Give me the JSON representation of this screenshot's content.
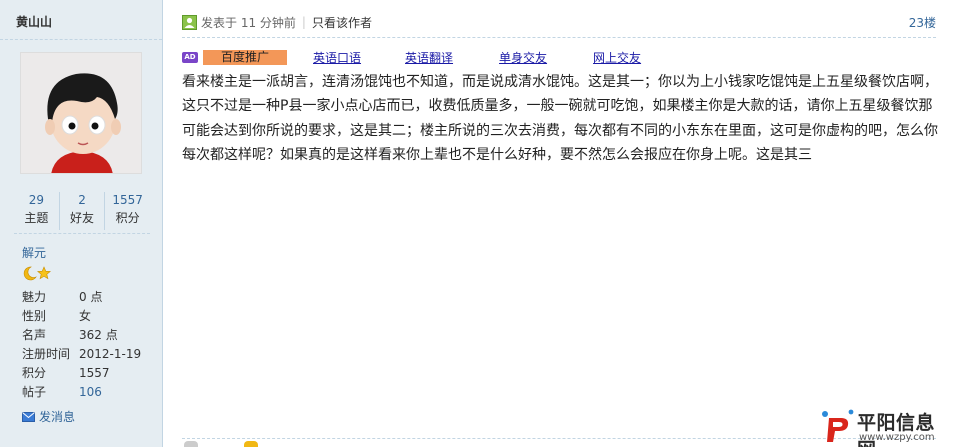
{
  "author": {
    "name": "黄山山",
    "stats": [
      {
        "value": "29",
        "label": "主题"
      },
      {
        "value": "2",
        "label": "好友"
      },
      {
        "value": "1557",
        "label": "积分"
      }
    ],
    "rank": "解元",
    "profile": [
      {
        "key": "魅力",
        "value": "0 点"
      },
      {
        "key": "性别",
        "value": "女"
      },
      {
        "key": "名声",
        "value": "362 点"
      },
      {
        "key": "注册时间",
        "value": "2012-1-19"
      },
      {
        "key": "积分",
        "value": "1557"
      },
      {
        "key": "帖子",
        "value": "106"
      }
    ],
    "pm_label": "发消息"
  },
  "post": {
    "posted": "发表于 11 分钟前",
    "only_author": "只看该作者",
    "floor": "23楼",
    "ad_tag": "AD",
    "ad_main": "百度推广",
    "ad_links": [
      "英语口语",
      "英语翻译",
      "单身交友",
      "网上交友"
    ],
    "body": "看来楼主是一派胡言，连清汤馄饨也不知道，而是说成清水馄饨。这是其一；你以为上小钱家吃馄饨是上五星级餐饮店啊，这只不过是一种P县一家小点心店而已，收费低质量多，一般一碗就可吃饱，如果楼主你是大款的话，请你上五星级餐饮那可能会达到你所说的要求，这是其二；楼主所说的三次去消费，每次都有不同的小东东在里面，这可是你虚构的吧，怎么你每次都这样呢？如果真的是这样看来你上辈也不是什么好种，要不然怎么会报应在你身上呢。这是其三"
  },
  "watermark": {
    "name": "平阳信息网",
    "url": "www.wzpy.com"
  },
  "colors": {
    "sidebar_bg": "#e5edf2",
    "link": "#336699",
    "ad_orange": "#f39758",
    "ad_purple": "#7a45c8"
  }
}
